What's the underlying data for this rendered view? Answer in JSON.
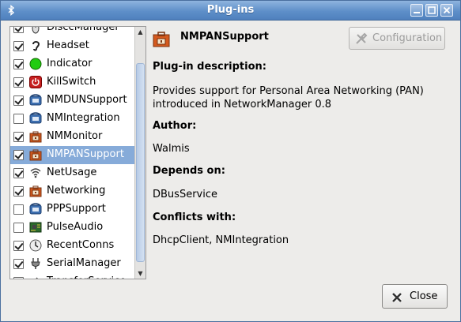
{
  "window": {
    "title": "Plug-ins"
  },
  "plugins": [
    {
      "label": "DisccManager",
      "checked": true,
      "icon": "mouse-icon",
      "selected": false
    },
    {
      "label": "Headset",
      "checked": true,
      "icon": "ear-icon",
      "selected": false
    },
    {
      "label": "Indicator",
      "checked": true,
      "icon": "green-dot-icon",
      "selected": false
    },
    {
      "label": "KillSwitch",
      "checked": true,
      "icon": "power-icon",
      "selected": false
    },
    {
      "label": "NMDUNSupport",
      "checked": true,
      "icon": "phone-icon",
      "selected": false
    },
    {
      "label": "NMIntegration",
      "checked": false,
      "icon": "phone-icon",
      "selected": false
    },
    {
      "label": "NMMonitor",
      "checked": true,
      "icon": "toolbox-icon",
      "selected": false
    },
    {
      "label": "NMPANSupport",
      "checked": true,
      "icon": "toolbox-icon",
      "selected": true
    },
    {
      "label": "NetUsage",
      "checked": true,
      "icon": "wifi-icon",
      "selected": false
    },
    {
      "label": "Networking",
      "checked": true,
      "icon": "toolbox-icon",
      "selected": false
    },
    {
      "label": "PPPSupport",
      "checked": false,
      "icon": "phone-icon",
      "selected": false
    },
    {
      "label": "PulseAudio",
      "checked": false,
      "icon": "circuit-board-icon",
      "selected": false
    },
    {
      "label": "RecentConns",
      "checked": true,
      "icon": "clock-icon",
      "selected": false
    },
    {
      "label": "SerialManager",
      "checked": true,
      "icon": "serial-plug-icon",
      "selected": false
    },
    {
      "label": "TransferService",
      "checked": false,
      "icon": "transfer-icon",
      "selected": false
    }
  ],
  "details": {
    "name": "NMPANSupport",
    "configuration_label": "Configuration",
    "description_heading": "Plug-in description:",
    "description": "Provides support for Personal Area Networking (PAN) introduced in NetworkManager 0.8",
    "author_heading": "Author:",
    "author": "Walmis",
    "depends_heading": "Depends on:",
    "depends": "DBusService",
    "conflicts_heading": "Conflicts with:",
    "conflicts": "DhcpClient, NMIntegration"
  },
  "close_label": "Close",
  "colors": {
    "titlebar": "#5e8fc9",
    "selection": "#86abd9"
  }
}
